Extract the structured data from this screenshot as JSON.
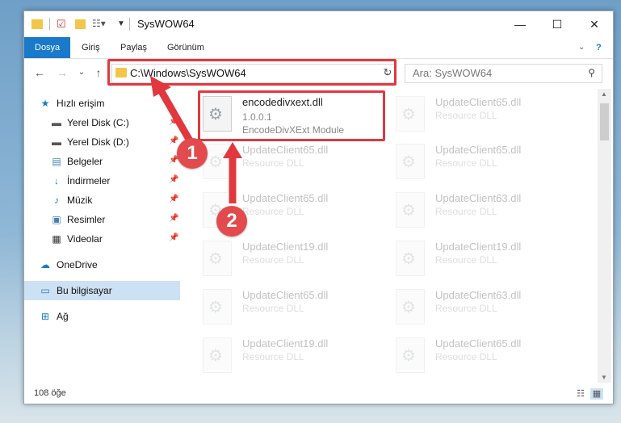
{
  "window": {
    "title": "SysWOW64",
    "minimize": "—",
    "maximize": "☐",
    "close": "✕"
  },
  "ribbon": {
    "tabs": [
      "Dosya",
      "Giriş",
      "Paylaş",
      "Görünüm"
    ],
    "help": "?"
  },
  "nav": {
    "address": "C:\\Windows\\SysWOW64",
    "search_placeholder": "Ara: SysWOW64"
  },
  "sidebar": {
    "quick_access": "Hızlı erişim",
    "items": [
      {
        "label": "Yerel Disk (C:)",
        "icon": "drive-icon"
      },
      {
        "label": "Yerel Disk (D:)",
        "icon": "drive-icon"
      },
      {
        "label": "Belgeler",
        "icon": "documents-icon"
      },
      {
        "label": "İndirmeler",
        "icon": "download-icon"
      },
      {
        "label": "Müzik",
        "icon": "music-icon"
      },
      {
        "label": "Resimler",
        "icon": "pictures-icon"
      },
      {
        "label": "Videolar",
        "icon": "video-icon"
      }
    ],
    "onedrive": "OneDrive",
    "this_pc": "Bu bilgisayar",
    "network": "Ağ"
  },
  "files": {
    "highlighted": {
      "name": "encodedivxext.dll",
      "version": "1.0.0.1",
      "description": "EncodeDivXExt Module"
    },
    "left_column": [
      {
        "name": "UpdateClient65.dll",
        "type": "Resource DLL"
      },
      {
        "name": "UpdateClient65.dll",
        "type": "Resource DLL"
      },
      {
        "name": "UpdateClient19.dll",
        "type": "Resource DLL"
      },
      {
        "name": "UpdateClient65.dll",
        "type": "Resource DLL"
      },
      {
        "name": "UpdateClient19.dll",
        "type": "Resource DLL"
      }
    ],
    "right_column": [
      {
        "name": "UpdateClient65.dll",
        "type": "Resource DLL"
      },
      {
        "name": "UpdateClient65.dll",
        "type": "Resource DLL"
      },
      {
        "name": "UpdateClient63.dll",
        "type": "Resource DLL"
      },
      {
        "name": "UpdateClient19.dll",
        "type": "Resource DLL"
      },
      {
        "name": "UpdateClient63.dll",
        "type": "Resource DLL"
      },
      {
        "name": "UpdateClient65.dll",
        "type": "Resource DLL"
      }
    ]
  },
  "status": {
    "count": "108 öğe"
  },
  "annotations": {
    "step1": "1",
    "step2": "2",
    "color": "#e0383e"
  }
}
